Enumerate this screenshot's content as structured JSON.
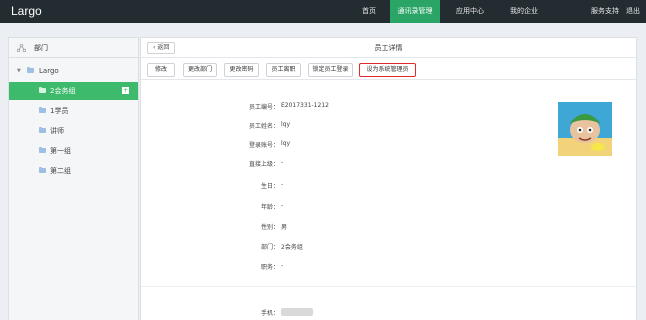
{
  "app": {
    "title": "Largo"
  },
  "nav": {
    "items": [
      {
        "label": "首页",
        "active": false
      },
      {
        "label": "通讯录管理",
        "active": true
      },
      {
        "label": "应用中心",
        "active": false
      },
      {
        "label": "我的企业",
        "active": false
      }
    ],
    "right": [
      "服务支持",
      "退出"
    ]
  },
  "sidebar": {
    "header": "部门",
    "root": "Largo",
    "items": [
      {
        "label": "2会务组",
        "selected": true,
        "action": "+"
      },
      {
        "label": "1学员",
        "selected": false
      },
      {
        "label": "讲师",
        "selected": false
      },
      {
        "label": "第一组",
        "selected": false
      },
      {
        "label": "第二组",
        "selected": false
      }
    ]
  },
  "main": {
    "back_label": "返回",
    "title": "员工详情",
    "toolbar": [
      "修改",
      "更改部门",
      "更改密码",
      "员工离职",
      "锁定员工登录",
      "设为系统管理员"
    ],
    "fields": [
      {
        "label": "员工编号：",
        "value": "E2017331-1212"
      },
      {
        "label": "员工姓名：",
        "value": "lqy"
      },
      {
        "label": "登录账号：",
        "value": "lqy"
      },
      {
        "label": "直接上级：",
        "value": "-"
      },
      {
        "label": "生日：",
        "value": "-"
      },
      {
        "label": "年龄：",
        "value": "-"
      },
      {
        "label": "性别：",
        "value": "男"
      },
      {
        "label": "部门：",
        "value": "2会务组"
      },
      {
        "label": "职务：",
        "value": "-"
      }
    ],
    "phone_label": "手机："
  },
  "colors": {
    "topbar": "#222c31",
    "accent": "#2aa566",
    "selected_row": "#3dba6c",
    "highlight_border": "#e32a2a"
  }
}
